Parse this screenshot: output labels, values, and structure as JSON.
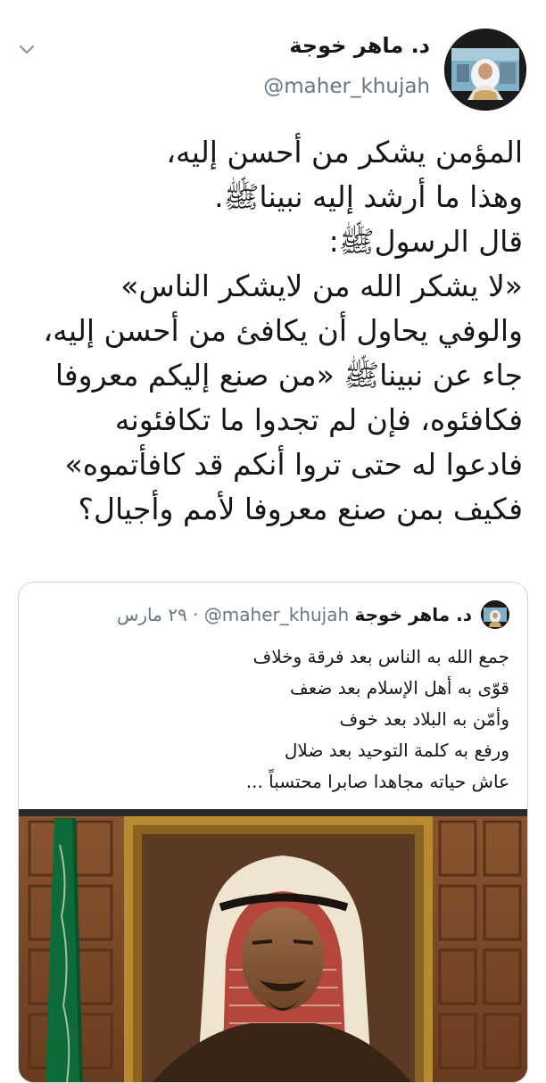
{
  "tweet": {
    "author_name": "د. ماهر خوجة",
    "author_handle": "@maher_khujah",
    "text_lines": [
      "المؤمن يشكر من أحسن إليه،",
      "وهذا ما أرشد إليه نبيناﷺ.",
      "قال الرسولﷺ:",
      "«لا يشكر الله من لايشكر الناس»",
      "والوفي يحاول أن يكافئ من أحسن إليه،",
      "جاء عن نبيناﷺ «من صنع إليكم معروفا",
      "فكافئوه، فإن لم تجدوا ما تكافئونه",
      "فادعوا له حتى تروا أنكم قد كافأتموه»",
      "فكيف بمن صنع معروفا لأمم وأجيال؟"
    ],
    "icons": {
      "menu": "chevron-down-icon"
    }
  },
  "quoted": {
    "author_name": "د. ماهر خوجة",
    "author_handle": "@maher_khujah",
    "separator": "·",
    "date": "٢٩ مارس",
    "text_lines": [
      "جمع الله به الناس بعد فرقة وخلاف",
      "قوّى به أهل الإسلام بعد ضعف",
      "وأمّن به البلاد بعد خوف",
      "ورفع به كلمة التوحيد بعد ضلال",
      "عاش حياته مجاهدا صابرا محتسباً ..."
    ]
  },
  "colors": {
    "primary_text": "#14171a",
    "secondary_text": "#657786",
    "border": "#ccd6dd",
    "flag_green": "#0d6b3a",
    "frame_gold": "#b8892f"
  }
}
